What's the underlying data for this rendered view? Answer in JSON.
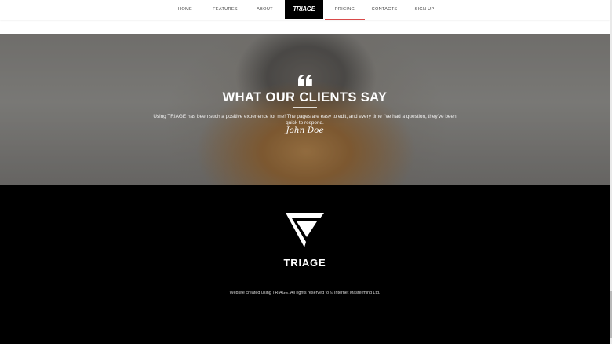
{
  "nav": {
    "items": [
      {
        "label": "HOME"
      },
      {
        "label": "FEATURES"
      },
      {
        "label": "ABOUT"
      },
      {
        "label": "PRICING"
      },
      {
        "label": "CONTACTS"
      },
      {
        "label": "SIGN UP"
      }
    ],
    "logo": "TRIAGE",
    "active_item": "PRICING",
    "accent_color": "#d94a4a"
  },
  "testimonial": {
    "icon": "quote-icon",
    "title": "WHAT OUR CLIENTS SAY",
    "quote": "Using TRIAGE has been such a positive experience for me! The pages are easy to edit, and every time I've had a question, they've been quick to respond.",
    "author": "John Doe"
  },
  "footer": {
    "logo_icon": "triage-logo-icon",
    "brand": "TRIAGE",
    "copyright": "Website created using TRIAGE. All rights reserved to © Internet Mastermind Ltd."
  }
}
